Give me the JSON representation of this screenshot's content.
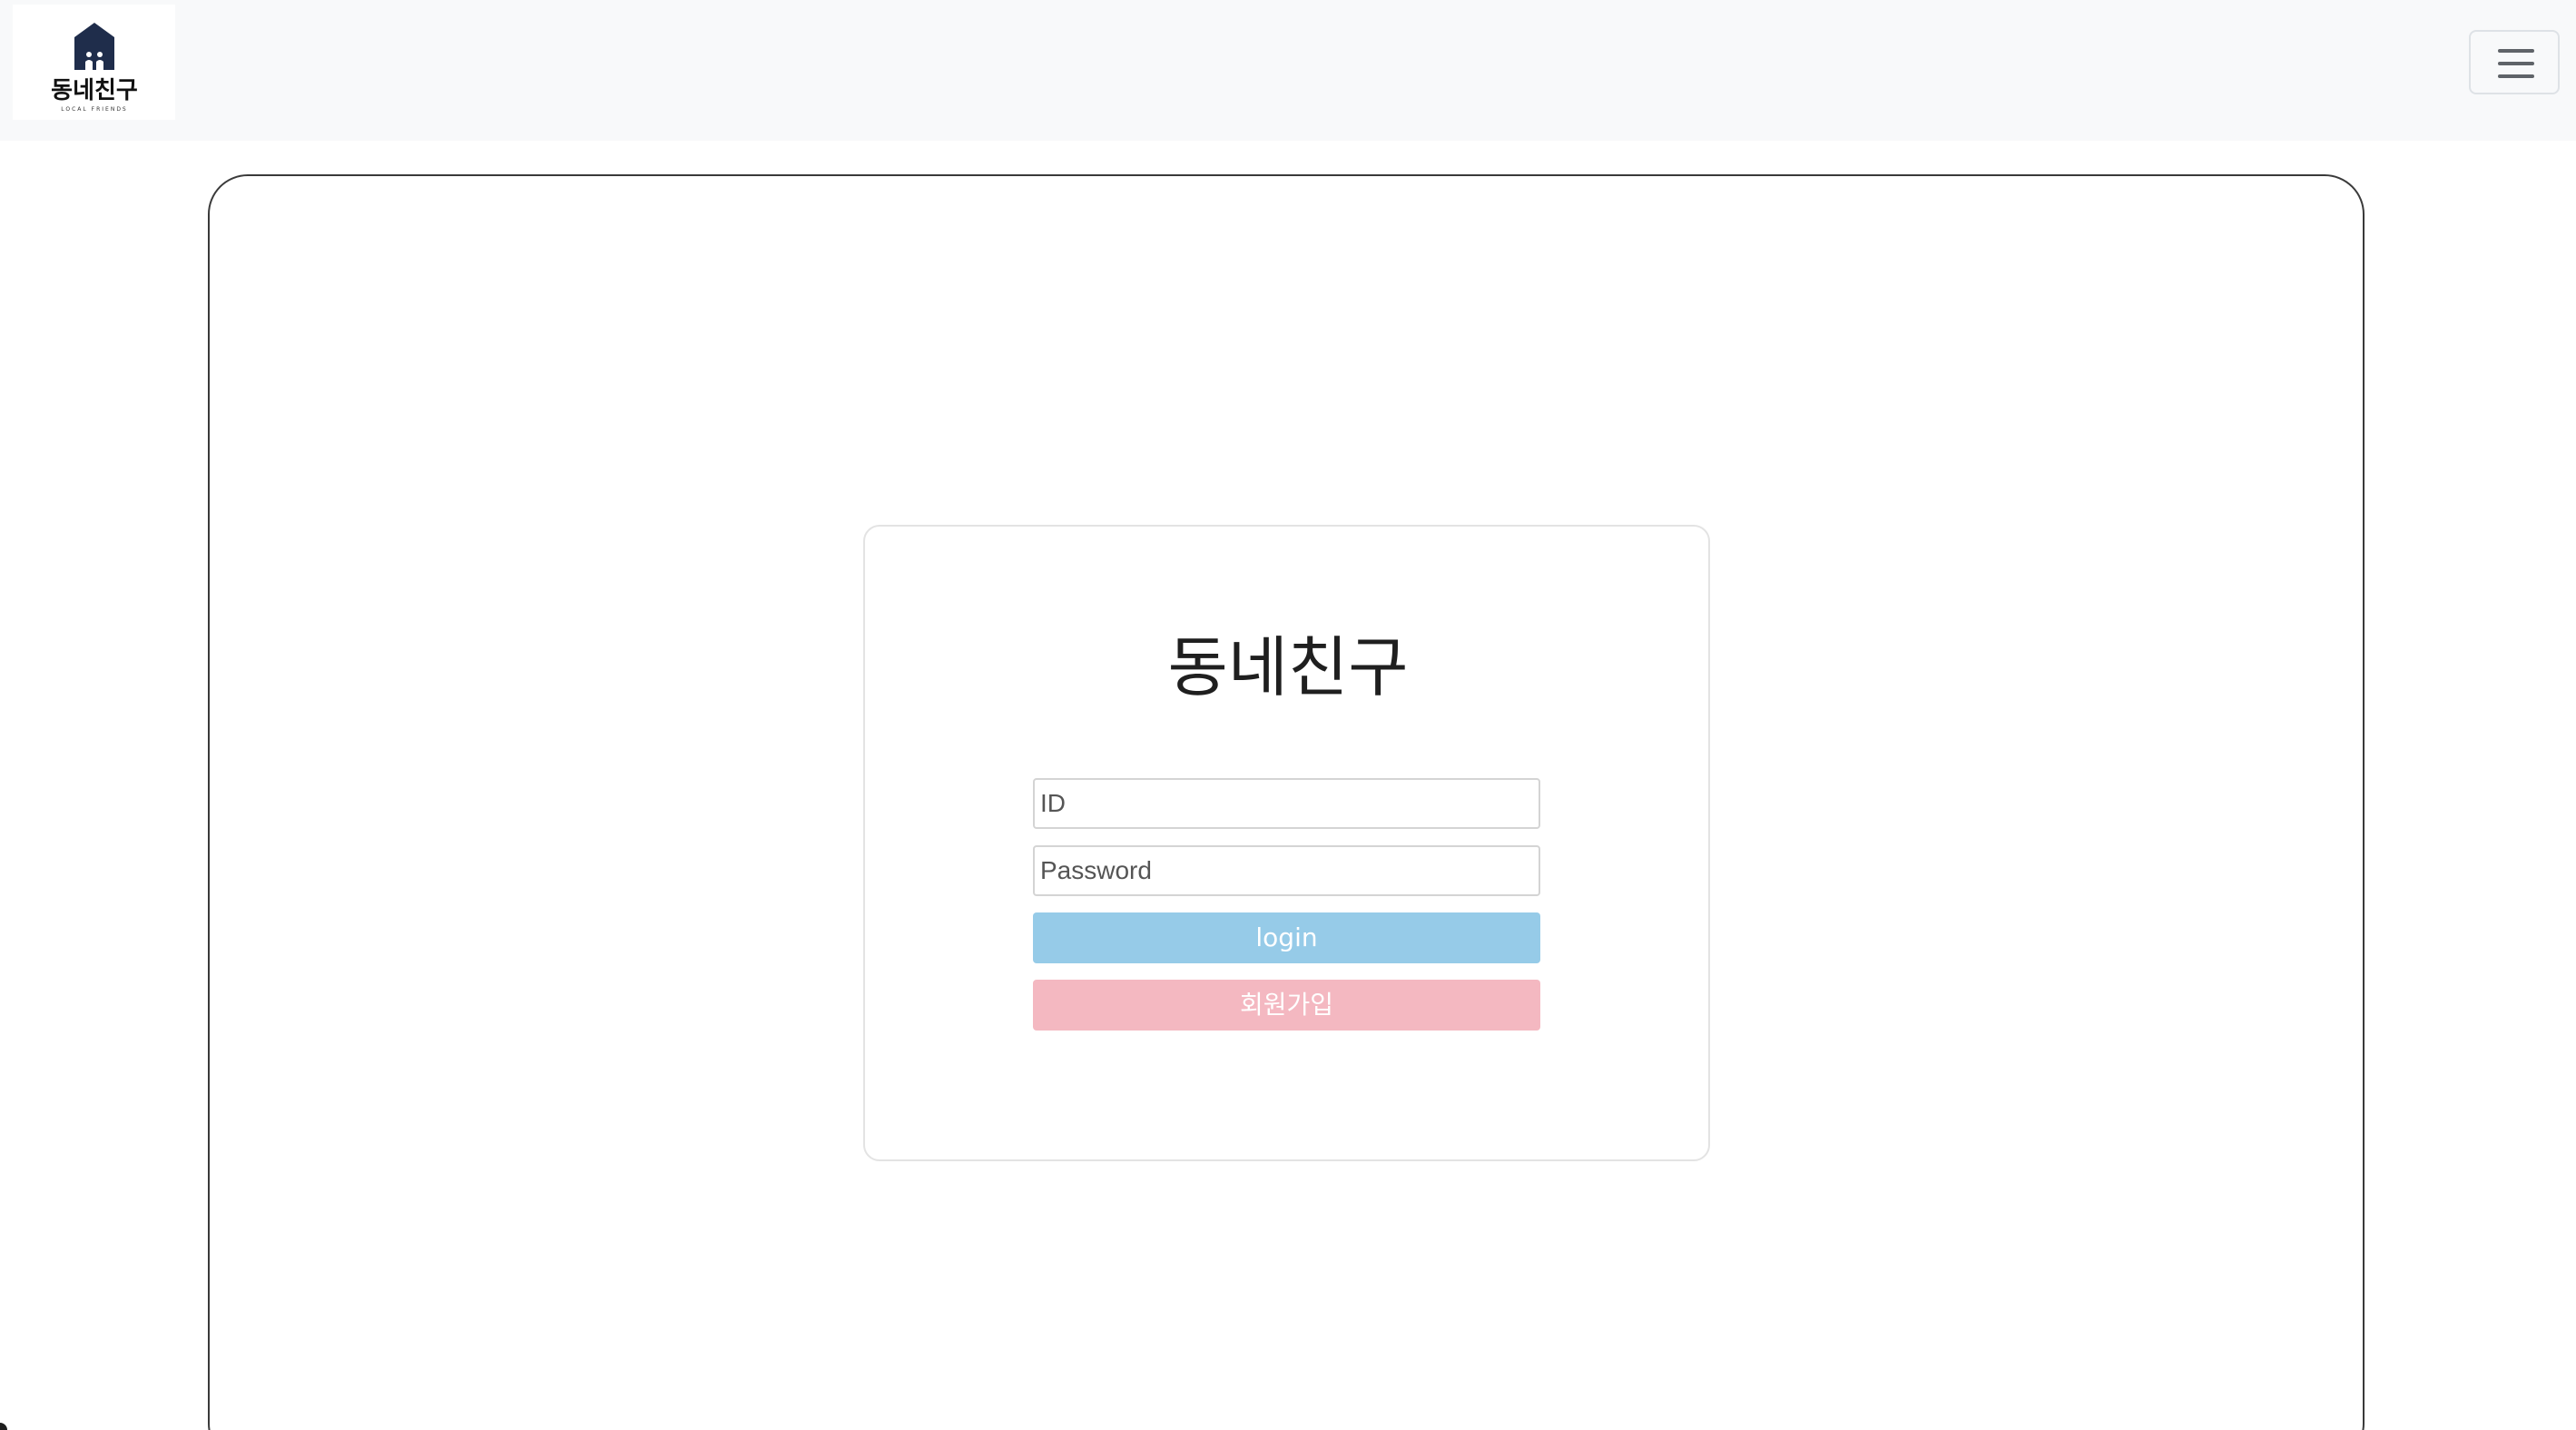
{
  "navbar": {
    "brand": {
      "logo_icon": "house-icon",
      "logo_text": "동네친구",
      "logo_subtext": "LOCAL FRIENDS"
    },
    "menu_toggle_icon": "hamburger-menu-icon"
  },
  "login_card": {
    "title": "동네친구",
    "id_input": {
      "placeholder": "ID",
      "value": ""
    },
    "password_input": {
      "placeholder": "Password",
      "value": ""
    },
    "login_button_label": "login",
    "signup_button_label": "회원가입"
  },
  "colors": {
    "navbar_bg": "#f8f9fa",
    "logo_navy": "#1f2d4b",
    "login_button": "#96cbe8",
    "signup_button": "#f4b8c1",
    "frame_border": "#3a3a3a",
    "card_border": "#e3e3e3"
  }
}
